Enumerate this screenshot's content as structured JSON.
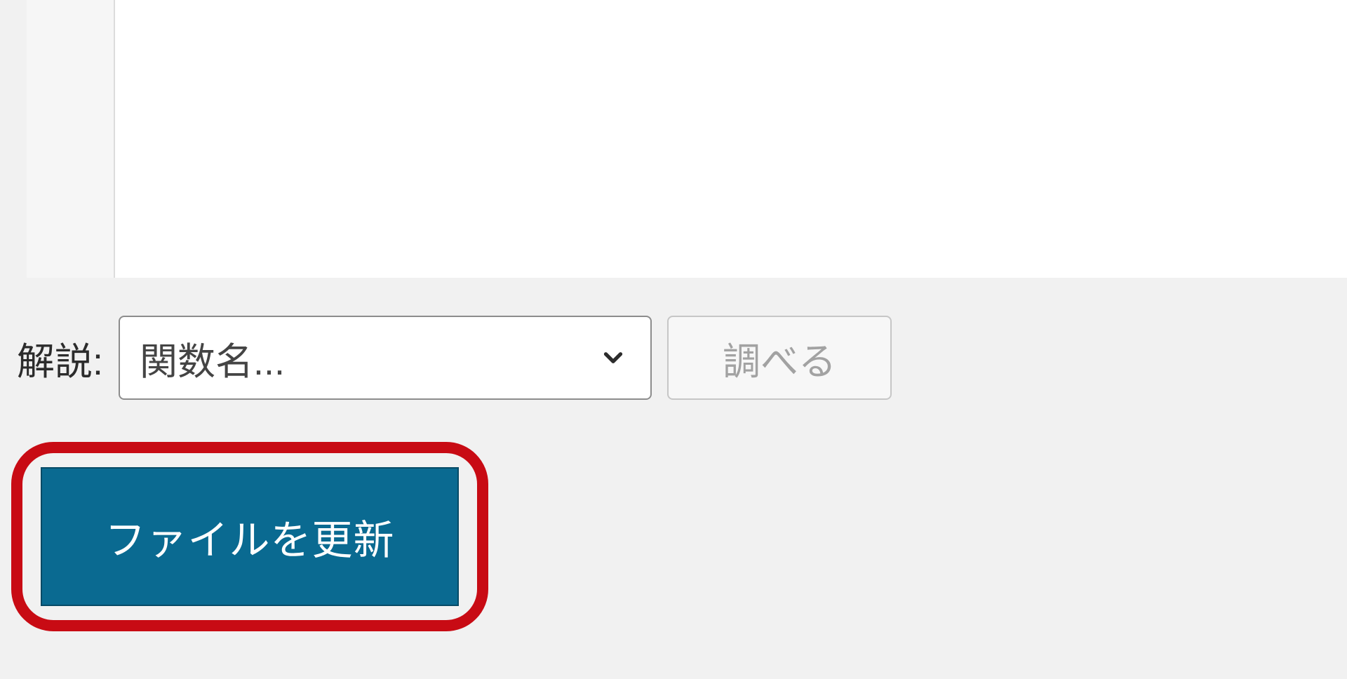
{
  "docs": {
    "label": "解説:",
    "function_select_placeholder": "関数名...",
    "lookup_button_label": "調べる"
  },
  "actions": {
    "update_file_label": "ファイルを更新"
  },
  "colors": {
    "annotation_border": "#c80b14",
    "primary_button_bg": "#0a6a91",
    "primary_button_text": "#ffffff"
  }
}
